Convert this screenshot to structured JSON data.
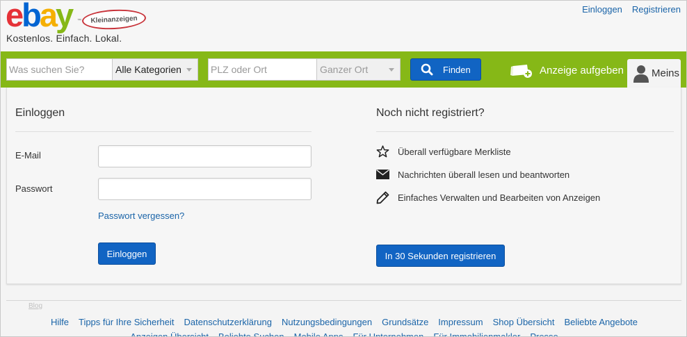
{
  "brand": {
    "logo_letters": [
      "e",
      "b",
      "a",
      "y"
    ],
    "badge": "Kleinanzeigen",
    "tagline": "Kostenlos. Einfach. Lokal.",
    "colors": {
      "red": "#e53238",
      "blue": "#0064d2",
      "yellow": "#f5af02",
      "green": "#86b817"
    }
  },
  "top_links": {
    "login": "Einloggen",
    "register": "Registrieren"
  },
  "search": {
    "query_placeholder": "Was suchen Sie?",
    "category_value": "Alle Kategorien",
    "location_placeholder": "PLZ oder Ort",
    "radius_value": "Ganzer Ort",
    "find_label": "Finden",
    "post_ad_label": "Anzeige aufgeben",
    "account_label": "Meins"
  },
  "login": {
    "title": "Einloggen",
    "email_label": "E-Mail",
    "email_value": "",
    "password_label": "Passwort",
    "password_value": "",
    "forgot_link": "Passwort vergessen?",
    "submit_label": "Einloggen"
  },
  "register": {
    "title": "Noch nicht registriert?",
    "features": [
      {
        "icon": "star-icon",
        "text": "Überall verfügbare Merkliste"
      },
      {
        "icon": "envelope-icon",
        "text": "Nachrichten überall lesen und beantworten"
      },
      {
        "icon": "pencil-icon",
        "text": "Einfaches Verwalten und Bearbeiten von Anzeigen"
      }
    ],
    "button_label": "In 30 Sekunden registrieren"
  },
  "footer": {
    "blog": "Blog",
    "row1": [
      "Hilfe",
      "Tipps für Ihre Sicherheit",
      "Datenschutzerklärung",
      "Nutzungsbedingungen",
      "Grundsätze",
      "Impressum",
      "Shop Übersicht",
      "Beliebte Angebote"
    ],
    "row2": [
      "Anzeigen Übersicht",
      "Beliebte Suchen",
      "Mobile Apps",
      "Für Unternehmen",
      "Für Immobilienmakler",
      "Presse"
    ]
  }
}
